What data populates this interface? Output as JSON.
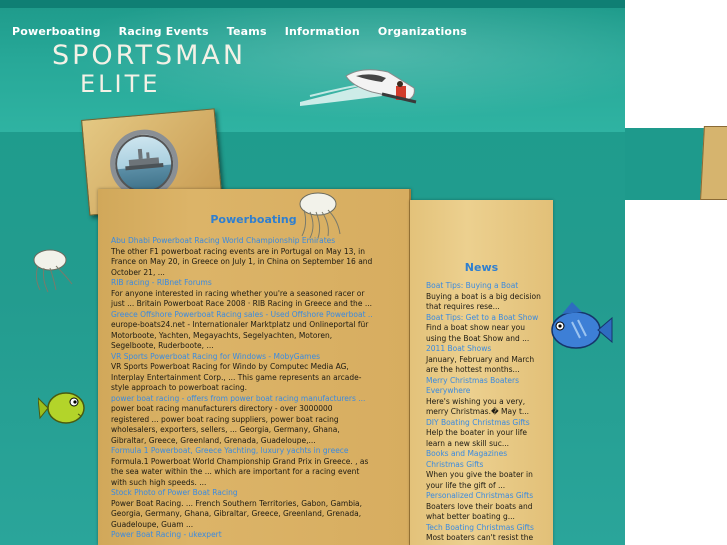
{
  "nav": {
    "items": [
      "Powerboating",
      "Racing Events",
      "Teams",
      "Information",
      "Organizations"
    ]
  },
  "logo": {
    "line1": "SPORTSMAN",
    "line2": "ELITE"
  },
  "colors": {
    "header_sea": "#27a898",
    "band": "#239c8f",
    "parchment": "#dcb468",
    "link": "#3a8ae0",
    "title": "#2f7fd0"
  },
  "main": {
    "title": "Powerboating",
    "entries": [
      {
        "link": "Abu Dhabi Powerboat Racing World Championship Emirates",
        "text": "The other F1 powerboat racing events are in Portugal on May 13, in France on May 20, in Greece on July 1, in China on September 16 and October 21, ..."
      },
      {
        "link": "RIB racing - RIBnet Forums",
        "text": "For anyone interested in racing whether you're a seasoned racer or just ... Britain Powerboat Race 2008 · RIB Racing in Greece and the ..."
      },
      {
        "link": "Greece Offshore Powerboat Racing sales - Used Offshore Powerboat ...",
        "text": "europe-boats24.net - Internationaler Marktplatz und Onlineportal für Motorboote, Yachten, Megayachts, Segelyachten, Motoren, Segelboote, Ruderboote, ..."
      },
      {
        "link": "VR Sports Powerboat Racing for Windows - MobyGames",
        "text": "VR Sports Powerboat Racing for Windo by Computec Media AG, Interplay Entertainment Corp., ... This game represents an arcade-style approach to powerboat racing."
      },
      {
        "link": "power boat racing - offers from power boat racing manufacturers ...",
        "text": "power boat racing manufacturers directory - over 3000000 registered ... power boat racing suppliers, power boat racing wholesalers, exporters, sellers, ... Georgia, Germany, Ghana, Gibraltar, Greece, Greenland, Grenada, Guadeloupe,..."
      },
      {
        "link": "Formula 1 Powerboat, Greece Yachting, luxury yachts in greece",
        "text": "Formula.1 Powerboat World Championship Grand Prix in Greece. , as the sea water within the ... which are important for a racing event with such high speeds. ..."
      },
      {
        "link": "Stock Photo of Power Boat Racing",
        "text": "Power Boat Racing. ... French Southern Territories, Gabon, Gambia, Georgia, Germany, Ghana, Gibraltar, Greece, Greenland, Grenada, Guadeloupe, Guam ..."
      },
      {
        "link": "Power Boat Racing - ukexpert",
        "text": ""
      }
    ]
  },
  "news": {
    "title": "News",
    "entries": [
      {
        "link": "Boat Tips: Buying a Boat",
        "text": "Buying a boat is a big decision that requires rese..."
      },
      {
        "link": "Boat Tips: Get to a Boat Show",
        "text": "Find a boat show near you using the Boat Show and ..."
      },
      {
        "link": "2011 Boat Shows",
        "text": "January, February and March are the hottest months..."
      },
      {
        "link": "Merry Christmas Boaters Everywhere",
        "text": "Here's wishing you a very, merry Christmas.� May t..."
      },
      {
        "link": "DIY Boating Christmas Gifts",
        "text": "Help the boater in your life learn a new skill suc..."
      },
      {
        "link": "Books and Magazines Christmas Gifts",
        "text": "When you give the boater in your life the gift of ..."
      },
      {
        "link": "Personalized Christmas Gifts",
        "text": "Boaters love their boats and what better boating g..."
      },
      {
        "link": "Tech Boating Christmas Gifts",
        "text": "Most boaters can't resist the"
      }
    ]
  },
  "decorations": [
    "jellyfish-icon",
    "jellyfish-icon",
    "blue-fish-icon",
    "green-fish-icon",
    "speedboat-icon",
    "ship-porthole-icon"
  ]
}
